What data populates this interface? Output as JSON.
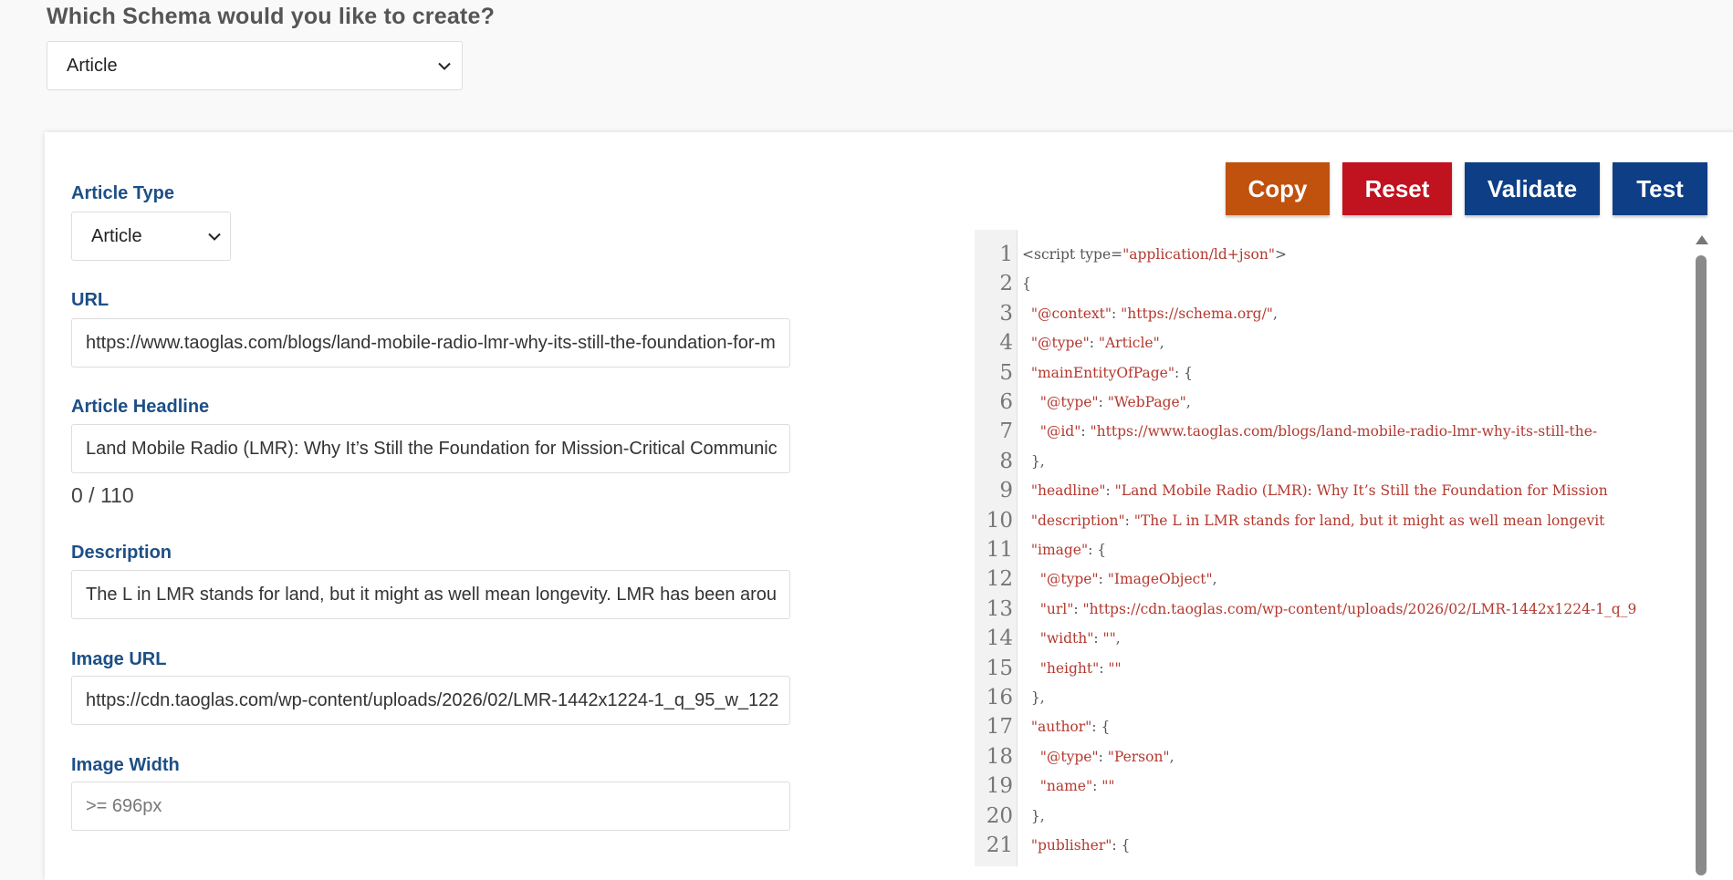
{
  "question": "Which Schema would you like to create?",
  "schema_select": {
    "value": "Article"
  },
  "form": {
    "article_type": {
      "label": "Article Type",
      "value": "Article"
    },
    "url": {
      "label": "URL",
      "value": "https://www.taoglas.com/blogs/land-mobile-radio-lmr-why-its-still-the-foundation-for-m"
    },
    "headline": {
      "label": "Article Headline",
      "value": "Land Mobile Radio (LMR): Why It’s Still the Foundation for Mission-Critical Communic",
      "counter": "0 / 110"
    },
    "description": {
      "label": "Description",
      "value": "The L in LMR stands for land, but it might as well mean longevity. LMR has been arou"
    },
    "image_url": {
      "label": "Image URL",
      "value": "https://cdn.taoglas.com/wp-content/uploads/2026/02/LMR-1442x1224-1_q_95_w_122"
    },
    "image_width": {
      "label": "Image Width",
      "placeholder": ">= 696px"
    }
  },
  "buttons": {
    "copy": "Copy",
    "reset": "Reset",
    "validate": "Validate",
    "test": "Test"
  },
  "colors": {
    "copy": "#c0520e",
    "reset": "#c1121f",
    "validate": "#0e3f86",
    "test": "#0e3f86",
    "label": "#1d4f86",
    "code_string": "#b3392f"
  },
  "code": {
    "line_numbers": [
      "1",
      "2",
      "3",
      "4",
      "5",
      "6",
      "7",
      "8",
      "9",
      "10",
      "11",
      "12",
      "13",
      "14",
      "15",
      "16",
      "17",
      "18",
      "19",
      "20",
      "21"
    ],
    "lines": [
      [
        {
          "t": "<script type=",
          "c": "p"
        },
        {
          "t": "\"application/ld+json\"",
          "c": "s"
        },
        {
          "t": ">",
          "c": "p"
        }
      ],
      [
        {
          "t": "{",
          "c": "p"
        }
      ],
      [
        {
          "t": "  ",
          "c": "p"
        },
        {
          "t": "\"@context\"",
          "c": "s"
        },
        {
          "t": ": ",
          "c": "p"
        },
        {
          "t": "\"https://schema.org/\"",
          "c": "s"
        },
        {
          "t": ",",
          "c": "p"
        }
      ],
      [
        {
          "t": "  ",
          "c": "p"
        },
        {
          "t": "\"@type\"",
          "c": "s"
        },
        {
          "t": ": ",
          "c": "p"
        },
        {
          "t": "\"Article\"",
          "c": "s"
        },
        {
          "t": ",",
          "c": "p"
        }
      ],
      [
        {
          "t": "  ",
          "c": "p"
        },
        {
          "t": "\"mainEntityOfPage\"",
          "c": "s"
        },
        {
          "t": ": {",
          "c": "p"
        }
      ],
      [
        {
          "t": "    ",
          "c": "p"
        },
        {
          "t": "\"@type\"",
          "c": "s"
        },
        {
          "t": ": ",
          "c": "p"
        },
        {
          "t": "\"WebPage\"",
          "c": "s"
        },
        {
          "t": ",",
          "c": "p"
        }
      ],
      [
        {
          "t": "    ",
          "c": "p"
        },
        {
          "t": "\"@id\"",
          "c": "s"
        },
        {
          "t": ": ",
          "c": "p"
        },
        {
          "t": "\"https://www.taoglas.com/blogs/land-mobile-radio-lmr-why-its-still-the-",
          "c": "s"
        }
      ],
      [
        {
          "t": "  },",
          "c": "p"
        }
      ],
      [
        {
          "t": "  ",
          "c": "p"
        },
        {
          "t": "\"headline\"",
          "c": "s"
        },
        {
          "t": ": ",
          "c": "p"
        },
        {
          "t": "\"Land Mobile Radio (LMR): Why It’s Still the Foundation for Mission",
          "c": "s"
        }
      ],
      [
        {
          "t": "  ",
          "c": "p"
        },
        {
          "t": "\"description\"",
          "c": "s"
        },
        {
          "t": ": ",
          "c": "p"
        },
        {
          "t": "\"The L in LMR stands for land, but it might as well mean longevit",
          "c": "s"
        }
      ],
      [
        {
          "t": "  ",
          "c": "p"
        },
        {
          "t": "\"image\"",
          "c": "s"
        },
        {
          "t": ": {",
          "c": "p"
        }
      ],
      [
        {
          "t": "    ",
          "c": "p"
        },
        {
          "t": "\"@type\"",
          "c": "s"
        },
        {
          "t": ": ",
          "c": "p"
        },
        {
          "t": "\"ImageObject\"",
          "c": "s"
        },
        {
          "t": ",",
          "c": "p"
        }
      ],
      [
        {
          "t": "    ",
          "c": "p"
        },
        {
          "t": "\"url\"",
          "c": "s"
        },
        {
          "t": ": ",
          "c": "p"
        },
        {
          "t": "\"https://cdn.taoglas.com/wp-content/uploads/2026/02/LMR-1442x1224-1_q_9",
          "c": "s"
        }
      ],
      [
        {
          "t": "    ",
          "c": "p"
        },
        {
          "t": "\"width\"",
          "c": "s"
        },
        {
          "t": ": ",
          "c": "p"
        },
        {
          "t": "\"\"",
          "c": "s"
        },
        {
          "t": ",",
          "c": "p"
        }
      ],
      [
        {
          "t": "    ",
          "c": "p"
        },
        {
          "t": "\"height\"",
          "c": "s"
        },
        {
          "t": ": ",
          "c": "p"
        },
        {
          "t": "\"\"",
          "c": "s"
        }
      ],
      [
        {
          "t": "  },",
          "c": "p"
        }
      ],
      [
        {
          "t": "  ",
          "c": "p"
        },
        {
          "t": "\"author\"",
          "c": "s"
        },
        {
          "t": ": {",
          "c": "p"
        }
      ],
      [
        {
          "t": "    ",
          "c": "p"
        },
        {
          "t": "\"@type\"",
          "c": "s"
        },
        {
          "t": ": ",
          "c": "p"
        },
        {
          "t": "\"Person\"",
          "c": "s"
        },
        {
          "t": ",",
          "c": "p"
        }
      ],
      [
        {
          "t": "    ",
          "c": "p"
        },
        {
          "t": "\"name\"",
          "c": "s"
        },
        {
          "t": ": ",
          "c": "p"
        },
        {
          "t": "\"\"",
          "c": "s"
        }
      ],
      [
        {
          "t": "  },",
          "c": "p"
        }
      ],
      [
        {
          "t": "  ",
          "c": "p"
        },
        {
          "t": "\"publisher\"",
          "c": "s"
        },
        {
          "t": ": {",
          "c": "p"
        }
      ]
    ]
  }
}
